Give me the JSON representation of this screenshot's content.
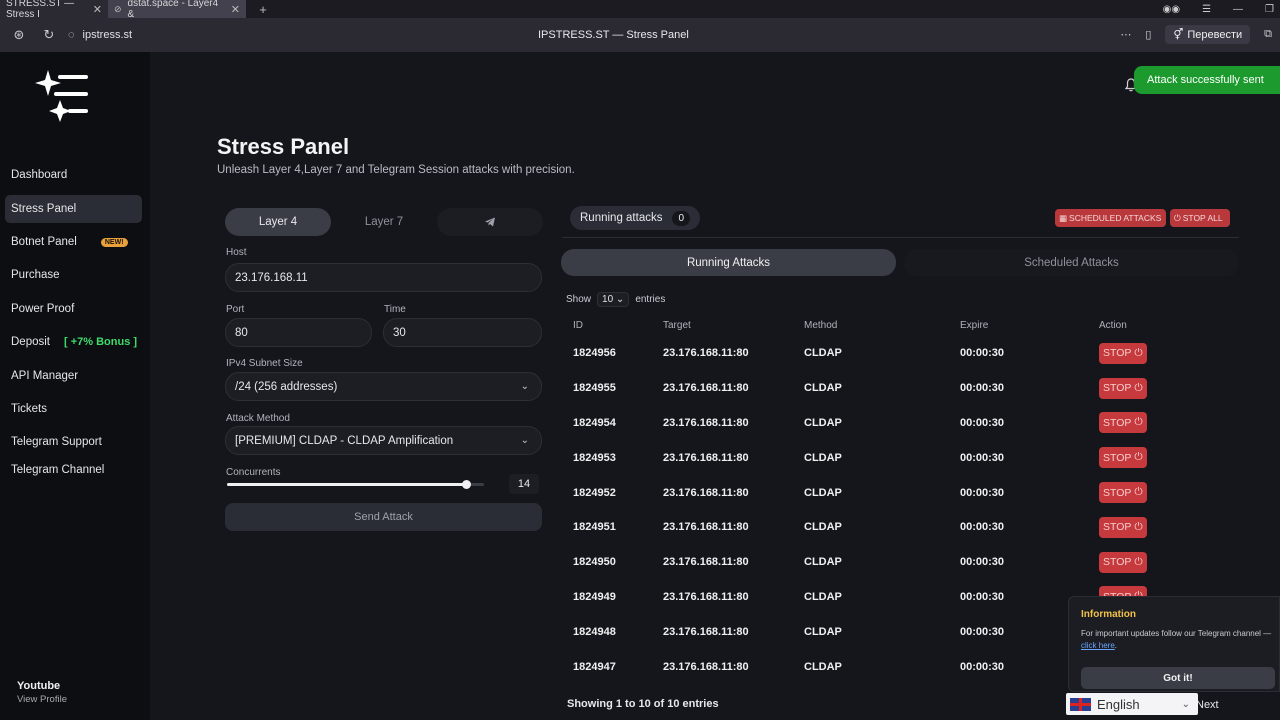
{
  "browser": {
    "tabs": [
      {
        "title": "STRESS.ST — Stress I",
        "active": true
      },
      {
        "title": "dstat.space - Layer4 &",
        "active": false
      }
    ],
    "url": "ipstress.st",
    "page_title": "IPSTRESS.ST — Stress Panel",
    "translate_label": "Перевести"
  },
  "sidebar": {
    "items": [
      {
        "label": "Dashboard"
      },
      {
        "label": "Stress Panel",
        "active": true
      },
      {
        "label": "Botnet Panel",
        "badge": "NEW!"
      },
      {
        "label": "Purchase"
      },
      {
        "label": "Power Proof"
      },
      {
        "label": "Deposit",
        "bonus": "[ +7% Bonus ]"
      },
      {
        "label": "API Manager"
      },
      {
        "label": "Tickets"
      },
      {
        "label": "Telegram Support"
      },
      {
        "label": "Telegram Channel"
      }
    ],
    "profile": {
      "name": "Youtube",
      "link": "View Profile"
    }
  },
  "header": {
    "title": "Stress Panel",
    "subtitle": "Unleash Layer 4,Layer 7 and Telegram Session attacks with precision.",
    "toast": "Attack successfully sent"
  },
  "form": {
    "tabs": {
      "layer4": "Layer 4",
      "layer7": "Layer 7"
    },
    "host": {
      "label": "Host",
      "value": "23.176.168.11"
    },
    "port": {
      "label": "Port",
      "value": "80"
    },
    "time": {
      "label": "Time",
      "value": "30"
    },
    "subnet": {
      "label": "IPv4 Subnet Size",
      "value": "/24 (256 addresses)"
    },
    "method": {
      "label": "Attack Method",
      "value": "[PREMIUM] CLDAP - CLDAP Amplification"
    },
    "concurrents": {
      "label": "Concurrents",
      "value": "14",
      "fraction": 0.93
    },
    "send_label": "Send Attack"
  },
  "attacks": {
    "running_label": "Running attacks",
    "running_count": "0",
    "scheduled_btn": "SCHEDULED ATTACKS",
    "stop_all_btn": "STOP ALL",
    "tabs": {
      "running": "Running Attacks",
      "scheduled": "Scheduled Attacks"
    },
    "show_label": "Show",
    "show_value": "10",
    "entries_label": "entries",
    "columns": [
      "ID",
      "Target",
      "Method",
      "Expire",
      "Action"
    ],
    "stop_label": "STOP",
    "rows": [
      {
        "id": "1824956",
        "target": "23.176.168.11:80",
        "method": "CLDAP",
        "expire": "00:00:30"
      },
      {
        "id": "1824955",
        "target": "23.176.168.11:80",
        "method": "CLDAP",
        "expire": "00:00:30"
      },
      {
        "id": "1824954",
        "target": "23.176.168.11:80",
        "method": "CLDAP",
        "expire": "00:00:30"
      },
      {
        "id": "1824953",
        "target": "23.176.168.11:80",
        "method": "CLDAP",
        "expire": "00:00:30"
      },
      {
        "id": "1824952",
        "target": "23.176.168.11:80",
        "method": "CLDAP",
        "expire": "00:00:30"
      },
      {
        "id": "1824951",
        "target": "23.176.168.11:80",
        "method": "CLDAP",
        "expire": "00:00:30"
      },
      {
        "id": "1824950",
        "target": "23.176.168.11:80",
        "method": "CLDAP",
        "expire": "00:00:30"
      },
      {
        "id": "1824949",
        "target": "23.176.168.11:80",
        "method": "CLDAP",
        "expire": "00:00:30"
      },
      {
        "id": "1824948",
        "target": "23.176.168.11:80",
        "method": "CLDAP",
        "expire": "00:00:30"
      },
      {
        "id": "1824947",
        "target": "23.176.168.11:80",
        "method": "CLDAP",
        "expire": "00:00:30"
      }
    ],
    "showing": "Showing 1 to 10 of 10 entries",
    "next": "Next"
  },
  "info": {
    "title": "Information",
    "text": "For important updates follow our Telegram channel —",
    "link": "click here",
    "button": "Got it!"
  },
  "language": {
    "value": "English"
  },
  "colors": {
    "accent_green": "#3ddc6a",
    "stop_red": "#c6393c",
    "toast_green": "#1c9a2e"
  }
}
